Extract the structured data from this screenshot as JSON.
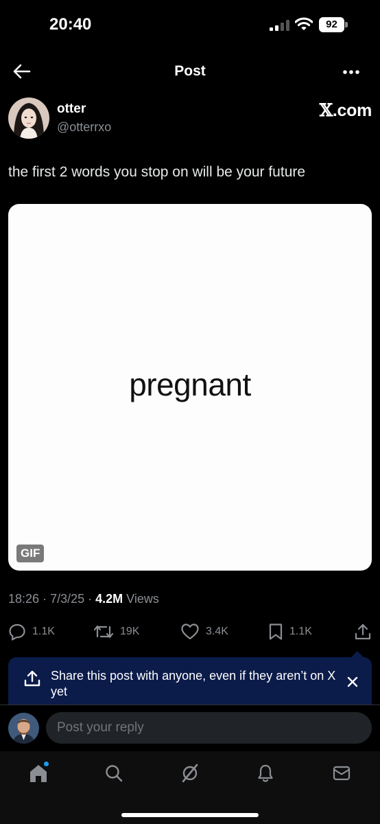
{
  "status_bar": {
    "time": "20:40",
    "battery": "92"
  },
  "nav": {
    "title": "Post"
  },
  "post": {
    "display_name": "otter",
    "handle": "@otterrxo",
    "source_label_x": "𝕏",
    "source_label_domain": ".com",
    "text": "the first 2 words you stop on will be your future",
    "media_word": "pregnant",
    "media_badge": "GIF",
    "time": "18:26",
    "date": "7/3/25",
    "views_count": "4.2M",
    "views_label": "Views"
  },
  "actions": {
    "replies": "1.1K",
    "reposts": "19K",
    "likes": "3.4K",
    "bookmarks": "1.1K"
  },
  "share_banner": {
    "text": "Share this post with anyone, even if they aren’t on X yet"
  },
  "reply": {
    "placeholder": "Post your reply"
  },
  "colors": {
    "accent": "#1d9bf0",
    "banner_bg": "#0b1b4a",
    "muted": "#8b8f94"
  },
  "icons": {
    "nav": [
      "back-arrow-icon",
      "more-icon"
    ],
    "actions": [
      "reply-icon",
      "repost-icon",
      "like-icon",
      "bookmark-icon",
      "share-icon"
    ],
    "tabs": [
      "home-icon",
      "search-icon",
      "grok-icon",
      "notifications-icon",
      "messages-icon"
    ]
  }
}
